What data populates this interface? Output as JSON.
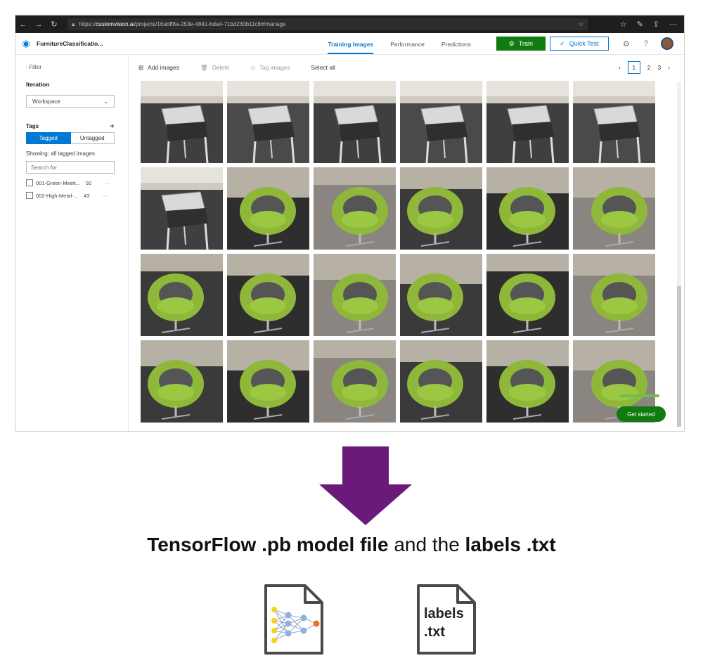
{
  "browser": {
    "url_prefix": "https://",
    "url_domain": "customvision.ai",
    "url_rest": "/projects/16abff8a-253e-4841-bda4-71bd230b11c8#/manage"
  },
  "header": {
    "project_name": "FurnitureClassificatio...",
    "tabs": [
      {
        "label": "Training Images",
        "active": true
      },
      {
        "label": "Performance",
        "active": false
      },
      {
        "label": "Predictions",
        "active": false
      }
    ],
    "train_label": "Train",
    "quick_test_label": "Quick Test"
  },
  "sidebar": {
    "filter_label": "Filter",
    "iteration_label": "Iteration",
    "iteration_value": "Workspace",
    "tags_label": "Tags",
    "tagged_label": "Tagged",
    "untagged_label": "Untagged",
    "showing_text": "Showing: all tagged images",
    "search_placeholder": "Search for",
    "tags": [
      {
        "name": "001-Green-Meeti...",
        "count": "92"
      },
      {
        "name": "002-High-Metal-...",
        "count": "43"
      }
    ]
  },
  "toolbar": {
    "add_images": "Add images",
    "delete": "Delete",
    "tag_images": "Tag images",
    "select_all": "Select all",
    "pages": [
      "1",
      "2",
      "3"
    ],
    "current_page": "1"
  },
  "images": {
    "rows": [
      [
        "high-metal-chair",
        "high-metal-chair",
        "high-metal-chair",
        "high-metal-chair",
        "high-metal-chair",
        "high-metal-chair"
      ],
      [
        "high-metal-chair",
        "green-chair",
        "green-chair",
        "green-chair",
        "green-chair",
        "green-chair"
      ],
      [
        "green-chair",
        "green-chair",
        "green-chair",
        "green-chair",
        "green-chair",
        "green-chair"
      ],
      [
        "green-chair",
        "green-chair",
        "green-chair",
        "green-chair",
        "green-chair",
        "green-chair"
      ]
    ]
  },
  "get_started_label": "Get started",
  "caption": {
    "part1": "TensorFlow .pb model file",
    "part2": " and the ",
    "part3": "labels .txt"
  },
  "labels_icon": {
    "line1": "labels",
    "line2": ".txt"
  },
  "colors": {
    "accent": "#0078d4",
    "train_green": "#107c10",
    "arrow_purple": "#6a1b7a",
    "chair_green": "#8fb83a"
  }
}
